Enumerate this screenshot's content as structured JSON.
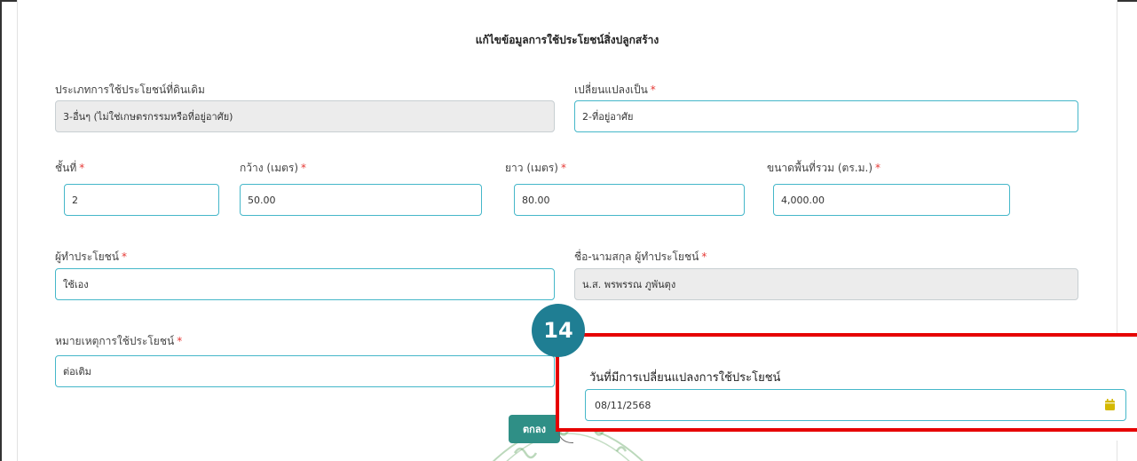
{
  "modal": {
    "title": "แก้ไขข้อมูลการใช้ประโยชน์สิ่งปลูกสร้าง",
    "required_mark": "*",
    "fields": {
      "original_use": {
        "label": "ประเภทการใช้ประโยชน์ที่ดินเดิม",
        "value": "3-อื่นๆ (ไม่ใช่เกษตรกรรมหรือที่อยู่อาศัย)"
      },
      "change_to": {
        "label": "เปลี่ยนแปลงเป็น",
        "value": "2-ที่อยู่อาศัย"
      },
      "floor": {
        "label": "ชั้นที่",
        "value": "2"
      },
      "width": {
        "label": "กว้าง (เมตร)",
        "value": "50.00"
      },
      "length": {
        "label": "ยาว (เมตร)",
        "value": "80.00"
      },
      "total_area": {
        "label": "ขนาดพื้นที่รวม (ตร.ม.)",
        "value": "4,000.00"
      },
      "user": {
        "label": "ผู้ทำประโยชน์",
        "value": "ใช้เอง"
      },
      "user_name": {
        "label": "ชื่อ-นามสกุล ผู้ทำประโยชน์",
        "value": "น.ส. พรพรรณ ภูพันตุง"
      },
      "usage_note": {
        "label": "หมายเหตุการใช้ประโยชน์",
        "value": "ต่อเติม"
      },
      "change_date": {
        "label": "วันที่มีการเปลี่ยนแปลงการใช้ประโยชน์",
        "value": "08/11/2568",
        "icon": "calendar-icon"
      }
    },
    "ok_label": "ตกลง"
  },
  "annotation": {
    "step_number": "14",
    "highlight_color": "#e60000",
    "badge_color": "#1f7e93"
  },
  "colors": {
    "field_border": "#45b7c9",
    "readonly_bg": "#ececec",
    "ok_button": "#2f8f86",
    "required": "#e53935"
  }
}
